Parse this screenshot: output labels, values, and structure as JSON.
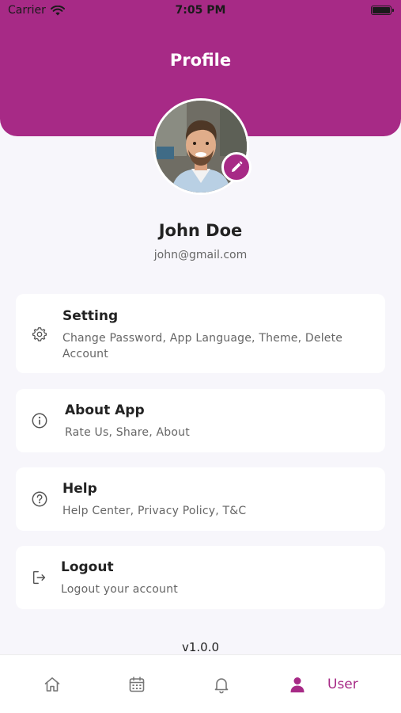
{
  "status_bar": {
    "carrier": "Carrier",
    "time": "7:05 PM"
  },
  "header": {
    "title": "Profile"
  },
  "profile": {
    "name": "John Doe",
    "email": "john@gmail.com"
  },
  "menu": [
    {
      "icon": "gear-icon",
      "title": "Setting",
      "subtitle": "Change Password, App Language, Theme, Delete Account"
    },
    {
      "icon": "info-icon",
      "title": "About App",
      "subtitle": "Rate Us, Share, About"
    },
    {
      "icon": "help-icon",
      "title": "Help",
      "subtitle": "Help Center, Privacy Policy, T&C"
    },
    {
      "icon": "logout-icon",
      "title": "Logout",
      "subtitle": "Logout your account"
    }
  ],
  "version": "v1.0.0",
  "bottom_nav": {
    "items": [
      "home-icon",
      "calendar-icon",
      "bell-icon",
      "user-icon"
    ],
    "active_label": "User"
  },
  "colors": {
    "accent": "#a72a86",
    "background": "#f7f6fb",
    "card": "#ffffff"
  }
}
